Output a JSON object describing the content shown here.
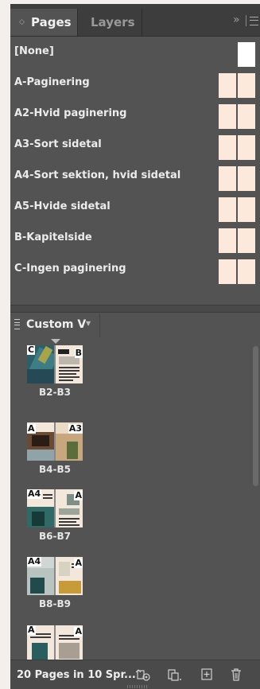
{
  "tabs": [
    {
      "label": "Pages",
      "active": true
    },
    {
      "label": "Layers",
      "active": false
    }
  ],
  "masters": [
    {
      "label": "[None]",
      "kind": "single"
    },
    {
      "label": "A-Paginering",
      "kind": "spread"
    },
    {
      "label": "A2-Hvid paginering",
      "kind": "spread"
    },
    {
      "label": "A3-Sort sidetal",
      "kind": "spread"
    },
    {
      "label": "A4-Sort sektion, hvid sidetal",
      "kind": "spread"
    },
    {
      "label": "A5-Hvide sidetal",
      "kind": "spread"
    },
    {
      "label": "B-Kapitelside",
      "kind": "spread"
    },
    {
      "label": "C-Ingen paginering",
      "kind": "spread"
    }
  ],
  "view": {
    "label": "Custom V"
  },
  "spreads": [
    {
      "label": "B2-B3",
      "left_master": "C",
      "right_master": "B"
    },
    {
      "label": "B4-B5",
      "left_master": "A",
      "right_master": "A3"
    },
    {
      "label": "B6-B7",
      "left_master": "A4",
      "right_master": "A"
    },
    {
      "label": "B8-B9",
      "left_master": "A4",
      "right_master": "A"
    },
    {
      "label": "",
      "left_master": "A",
      "right_master": "A"
    }
  ],
  "footer": {
    "status": "20 Pages in 10 Spr..."
  },
  "colors": {
    "panel": "#535353",
    "tabbar": "#3d3d3d",
    "master_page": "#fde9dc",
    "text": "#e6e6e6"
  }
}
